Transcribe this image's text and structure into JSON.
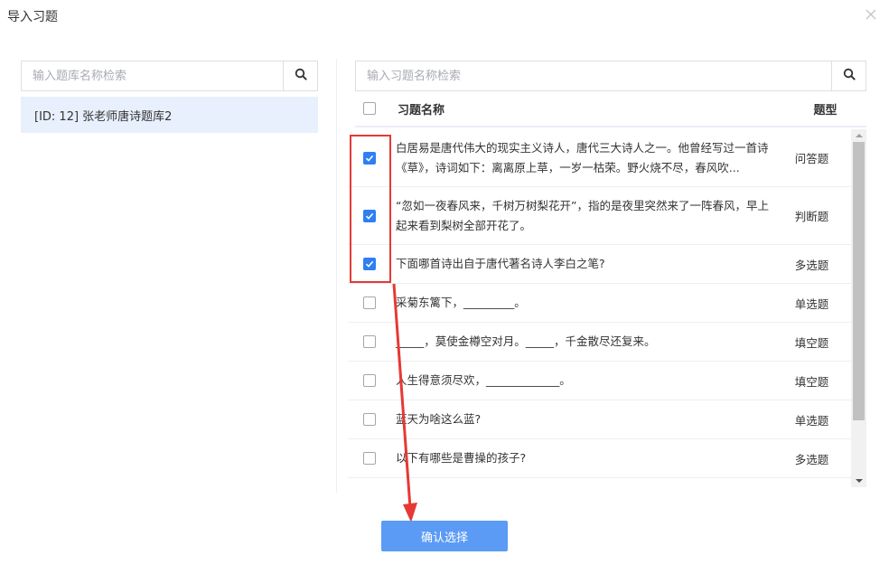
{
  "dialog": {
    "title": "导入习题"
  },
  "left": {
    "search_placeholder": "输入题库名称检索",
    "banks": [
      {
        "label": "[ID: 12] 张老师唐诗题库2",
        "selected": true
      }
    ]
  },
  "right": {
    "search_placeholder": "输入习题名称检索",
    "header": {
      "name": "习题名称",
      "type": "题型"
    },
    "rows": [
      {
        "name": "白居易是唐代伟大的现实主义诗人，唐代三大诗人之一。他曾经写过一首诗《草》，诗词如下：离离原上草，一岁一枯荣。野火烧不尽，春风吹...",
        "type": "问答题",
        "checked": true
      },
      {
        "name": "“忽如一夜春风来，千树万树梨花开”，指的是夜里突然来了一阵春风，早上起来看到梨树全部开花了。",
        "type": "判断题",
        "checked": true
      },
      {
        "name": "下面哪首诗出自于唐代著名诗人李白之笔?",
        "type": "多选题",
        "checked": true
      },
      {
        "name": "采菊东篱下，_________。",
        "type": "单选题",
        "checked": false
      },
      {
        "name": "_____，莫使金樽空对月。_____，千金散尽还复来。",
        "type": "填空题",
        "checked": false
      },
      {
        "name": "人生得意须尽欢，_____________。",
        "type": "填空题",
        "checked": false
      },
      {
        "name": "蓝天为啥这么蓝?",
        "type": "单选题",
        "checked": false
      },
      {
        "name": "以下有哪些是曹操的孩子?",
        "type": "多选题",
        "checked": false
      }
    ]
  },
  "footer": {
    "confirm_label": "确认选择"
  },
  "colors": {
    "accent": "#2f7ff2",
    "button": "#5b9bf5",
    "selected_bg": "#e8f0fd",
    "annotation": "#e53935"
  }
}
